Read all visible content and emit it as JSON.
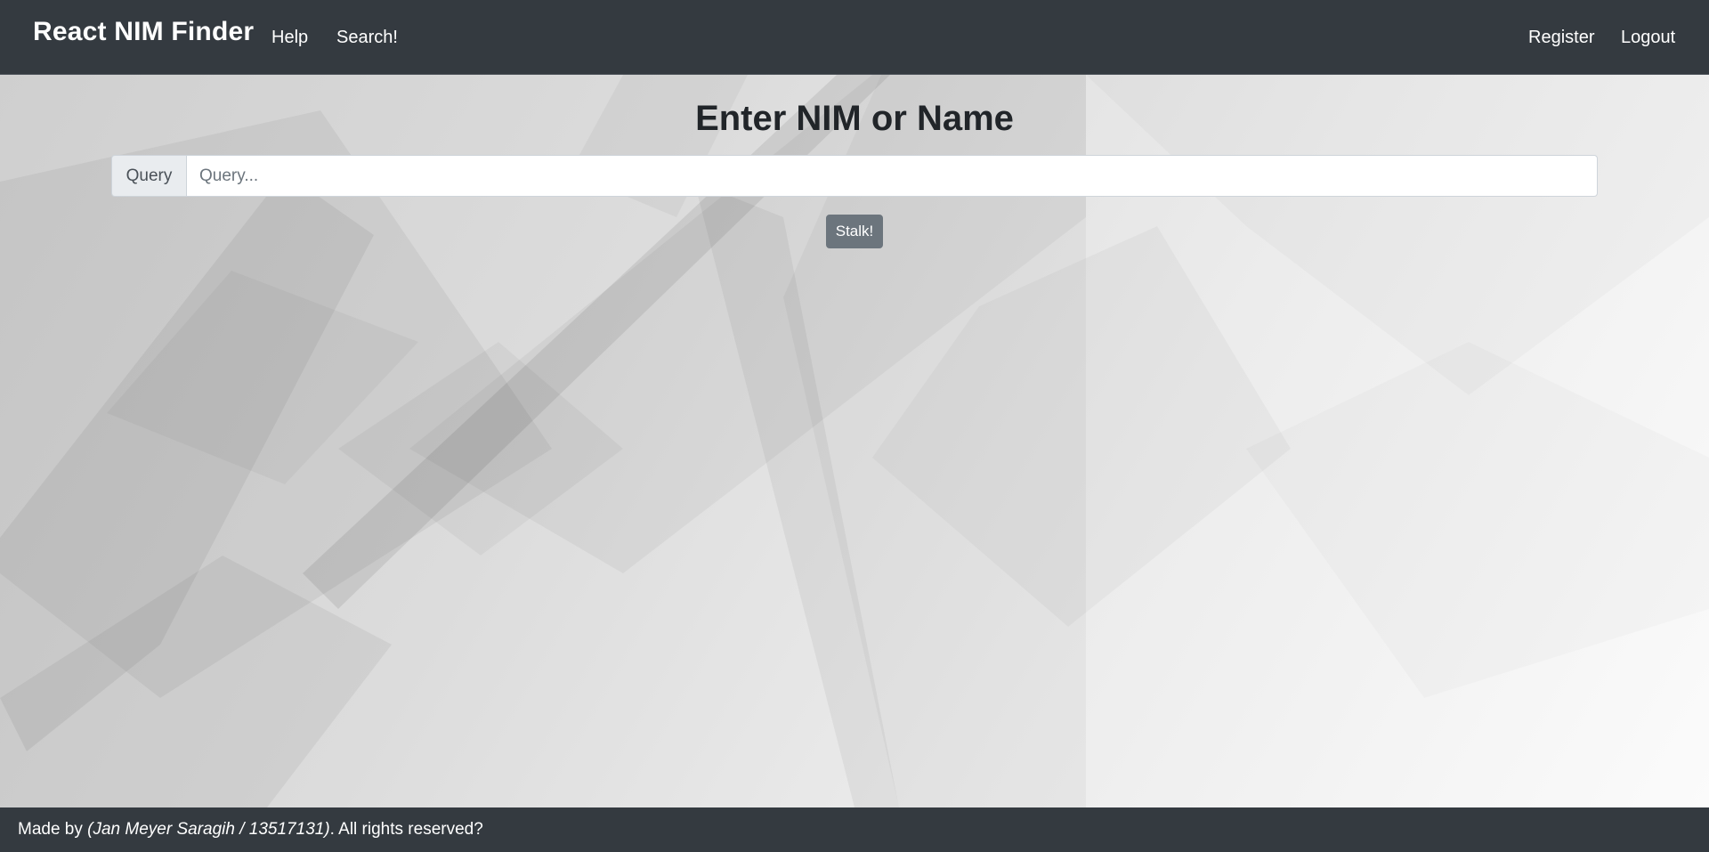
{
  "navbar": {
    "brand": "React NIM Finder",
    "links_left": [
      "Help",
      "Search!"
    ],
    "links_right": [
      "Register",
      "Logout"
    ],
    "background_color": "#343a40"
  },
  "main": {
    "title": "Enter NIM or Name",
    "search": {
      "prepend_label": "Query",
      "placeholder": "Query...",
      "value": ""
    },
    "submit_label": "Stalk!",
    "button_color": "#6c757d"
  },
  "footer": {
    "prefix": "Made by ",
    "author": "(Jan Meyer Saragih / 13517131)",
    "suffix": ". All rights reserved?",
    "background_color": "#343a40"
  }
}
